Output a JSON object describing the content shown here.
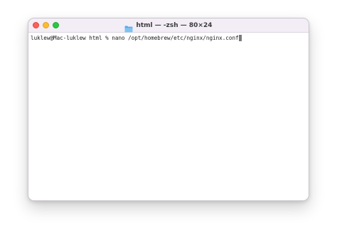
{
  "window": {
    "title": "html — -zsh — 80×24",
    "folder_icon": "folder-icon"
  },
  "traffic_lights": {
    "close_color": "#ff5f57",
    "minimize_color": "#febc2e",
    "zoom_color": "#28c840"
  },
  "terminal": {
    "prompt": "luklew@Mac-luklew html % ",
    "command": "nano /opt/homebrew/etc/nginx/nginx.conf"
  }
}
